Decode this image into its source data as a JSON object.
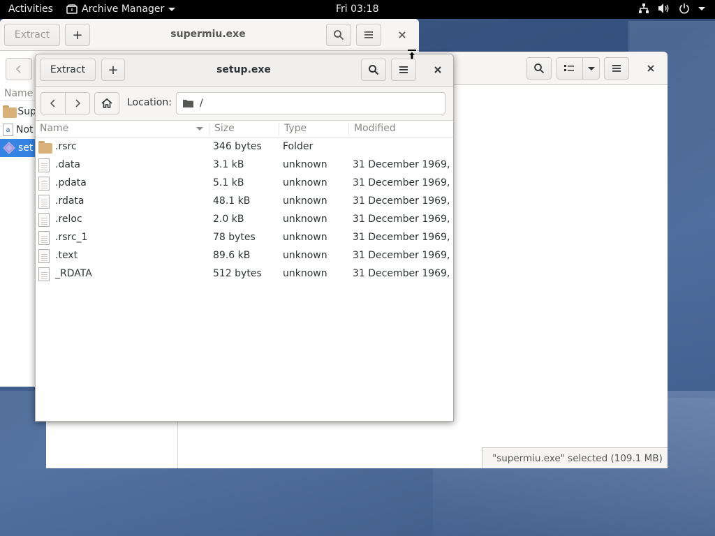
{
  "topbar": {
    "activities": "Activities",
    "app_name": "Archive Manager",
    "clock": "Fri 03:18"
  },
  "window_back": {
    "status_text": "\"supermiu.exe\" selected (109.1 MB)"
  },
  "window_supermiu": {
    "extract_label": "Extract",
    "add_label": "+",
    "title": "supermiu.exe",
    "list_header": "Name",
    "rows": [
      {
        "label": "Sup",
        "icon": "folder-icon",
        "selected": false
      },
      {
        "label": "Not",
        "icon": "text-file-icon",
        "selected": false
      },
      {
        "label": "set",
        "icon": "executable-icon",
        "selected": true
      }
    ]
  },
  "window_setup": {
    "extract_label": "Extract",
    "add_label": "+",
    "title": "setup.exe",
    "location_label": "Location:",
    "location_value": "/",
    "columns": {
      "name": "Name",
      "size": "Size",
      "type": "Type",
      "modified": "Modified"
    },
    "files": [
      {
        "name": ".rsrc",
        "size": "346 bytes",
        "type": "Folder",
        "modified": "",
        "icon": "folder-icon"
      },
      {
        "name": ".data",
        "size": "3.1 kB",
        "type": "unknown",
        "modified": "31 December 1969, ...",
        "icon": "file-icon"
      },
      {
        "name": ".pdata",
        "size": "5.1 kB",
        "type": "unknown",
        "modified": "31 December 1969, ...",
        "icon": "file-icon"
      },
      {
        "name": ".rdata",
        "size": "48.1 kB",
        "type": "unknown",
        "modified": "31 December 1969, ...",
        "icon": "file-icon"
      },
      {
        "name": ".reloc",
        "size": "2.0 kB",
        "type": "unknown",
        "modified": "31 December 1969, ...",
        "icon": "file-icon"
      },
      {
        "name": ".rsrc_1",
        "size": "78 bytes",
        "type": "unknown",
        "modified": "31 December 1969, ...",
        "icon": "file-icon"
      },
      {
        "name": ".text",
        "size": "89.6 kB",
        "type": "unknown",
        "modified": "31 December 1969, ...",
        "icon": "file-icon"
      },
      {
        "name": "_RDATA",
        "size": "512 bytes",
        "type": "unknown",
        "modified": "31 December 1969, ...",
        "icon": "file-icon"
      }
    ]
  }
}
